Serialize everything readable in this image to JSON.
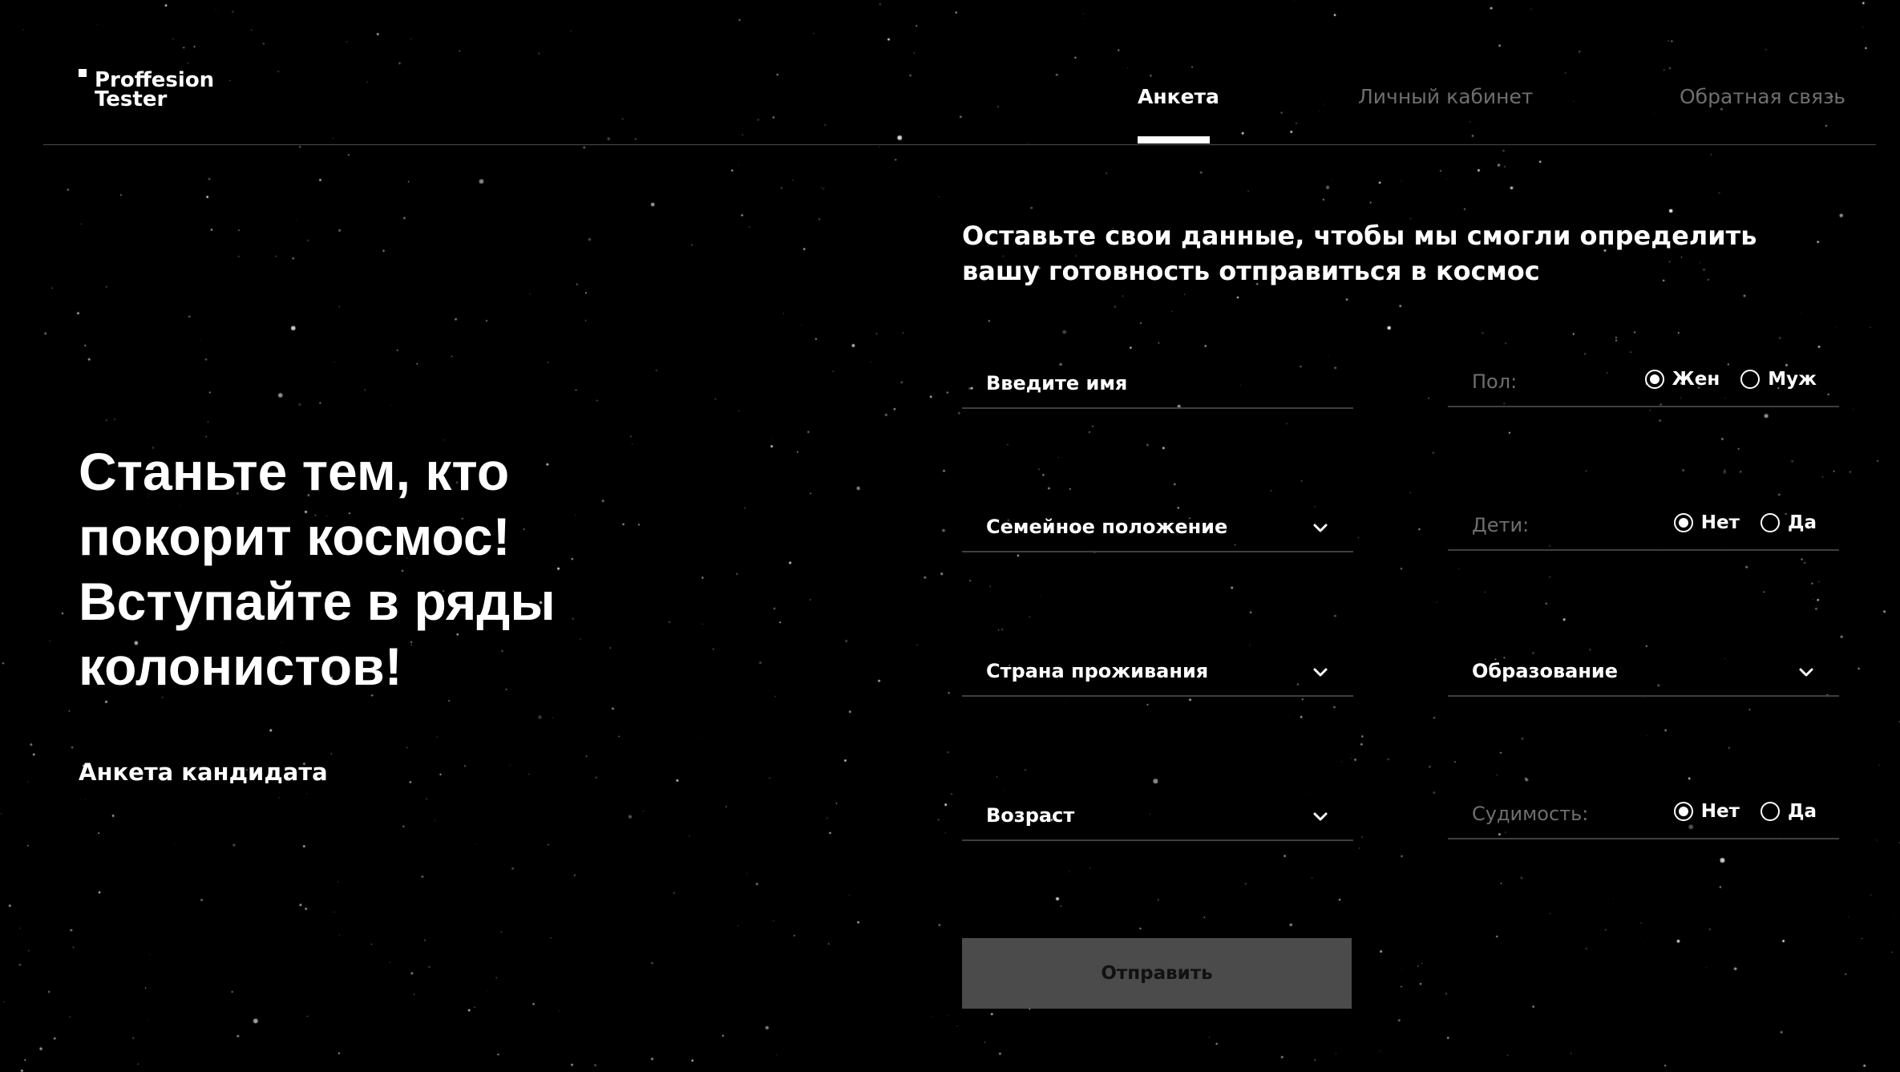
{
  "header": {
    "logo_line1": "Proffesion",
    "logo_line2": "Tester",
    "nav": [
      {
        "label": "Анкета",
        "active": true
      },
      {
        "label": "Личный кабинет",
        "active": false
      },
      {
        "label": "Обратная связь",
        "active": false
      }
    ]
  },
  "hero": {
    "title": "Станьте тем, кто\nпокорит космос!\nВступайте в ряды\nколонистов!",
    "subtitle": "Анкета кандидата"
  },
  "form": {
    "intro": "Оставьте свои данные, чтобы мы смогли определить вашу готовность отправиться в космос",
    "name_placeholder": "Введите имя",
    "gender_label": "Пол:",
    "gender_options": [
      {
        "label": "Жен",
        "checked": true
      },
      {
        "label": "Муж",
        "checked": false
      }
    ],
    "marital_status": "Семейное положение",
    "children_label": "Дети:",
    "children_options": [
      {
        "label": "Нет",
        "checked": true
      },
      {
        "label": "Да",
        "checked": false
      }
    ],
    "country": "Страна проживания",
    "education": "Образование",
    "age": "Возраст",
    "conviction_label": "Судимость:",
    "conviction_options": [
      {
        "label": "Нет",
        "checked": true
      },
      {
        "label": "Да",
        "checked": false
      }
    ],
    "submit_label": "Отправить"
  },
  "colors": {
    "background": "#000000",
    "text": "#ffffff",
    "muted": "#6e6e6e",
    "button": "#4b4b4b",
    "divider": "#3f3f3f"
  }
}
